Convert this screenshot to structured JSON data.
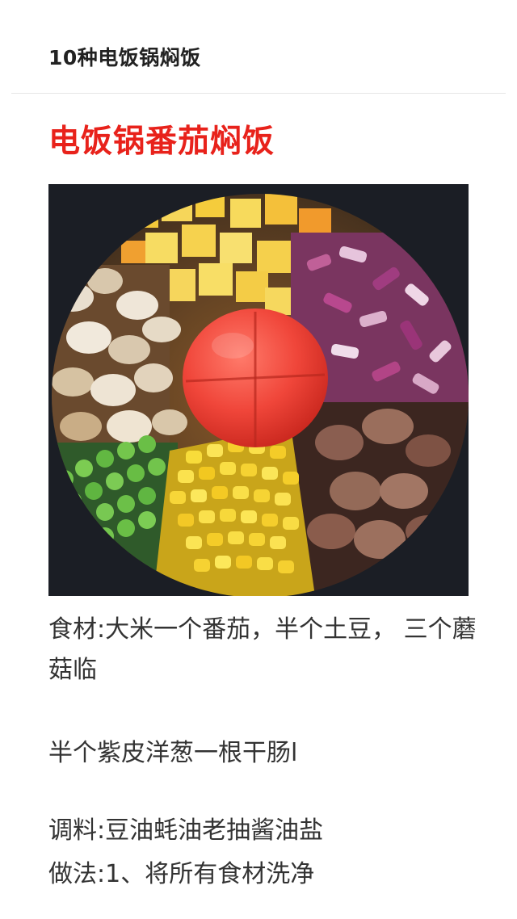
{
  "header": {
    "title": "10种电饭锅焖饭"
  },
  "article": {
    "section_title": "电饭锅番茄焖饭",
    "paragraphs": [
      "食材:大米一个番茄，半个土豆， 三个蘑菇临",
      "半个紫皮洋葱一根干肠l",
      "调料:豆油蚝油老抽酱油盐",
      "做法:1、将所有食材洗净"
    ]
  },
  "colors": {
    "title_red": "#e8221b",
    "text": "#333333",
    "divider": "#e6e6e6"
  }
}
